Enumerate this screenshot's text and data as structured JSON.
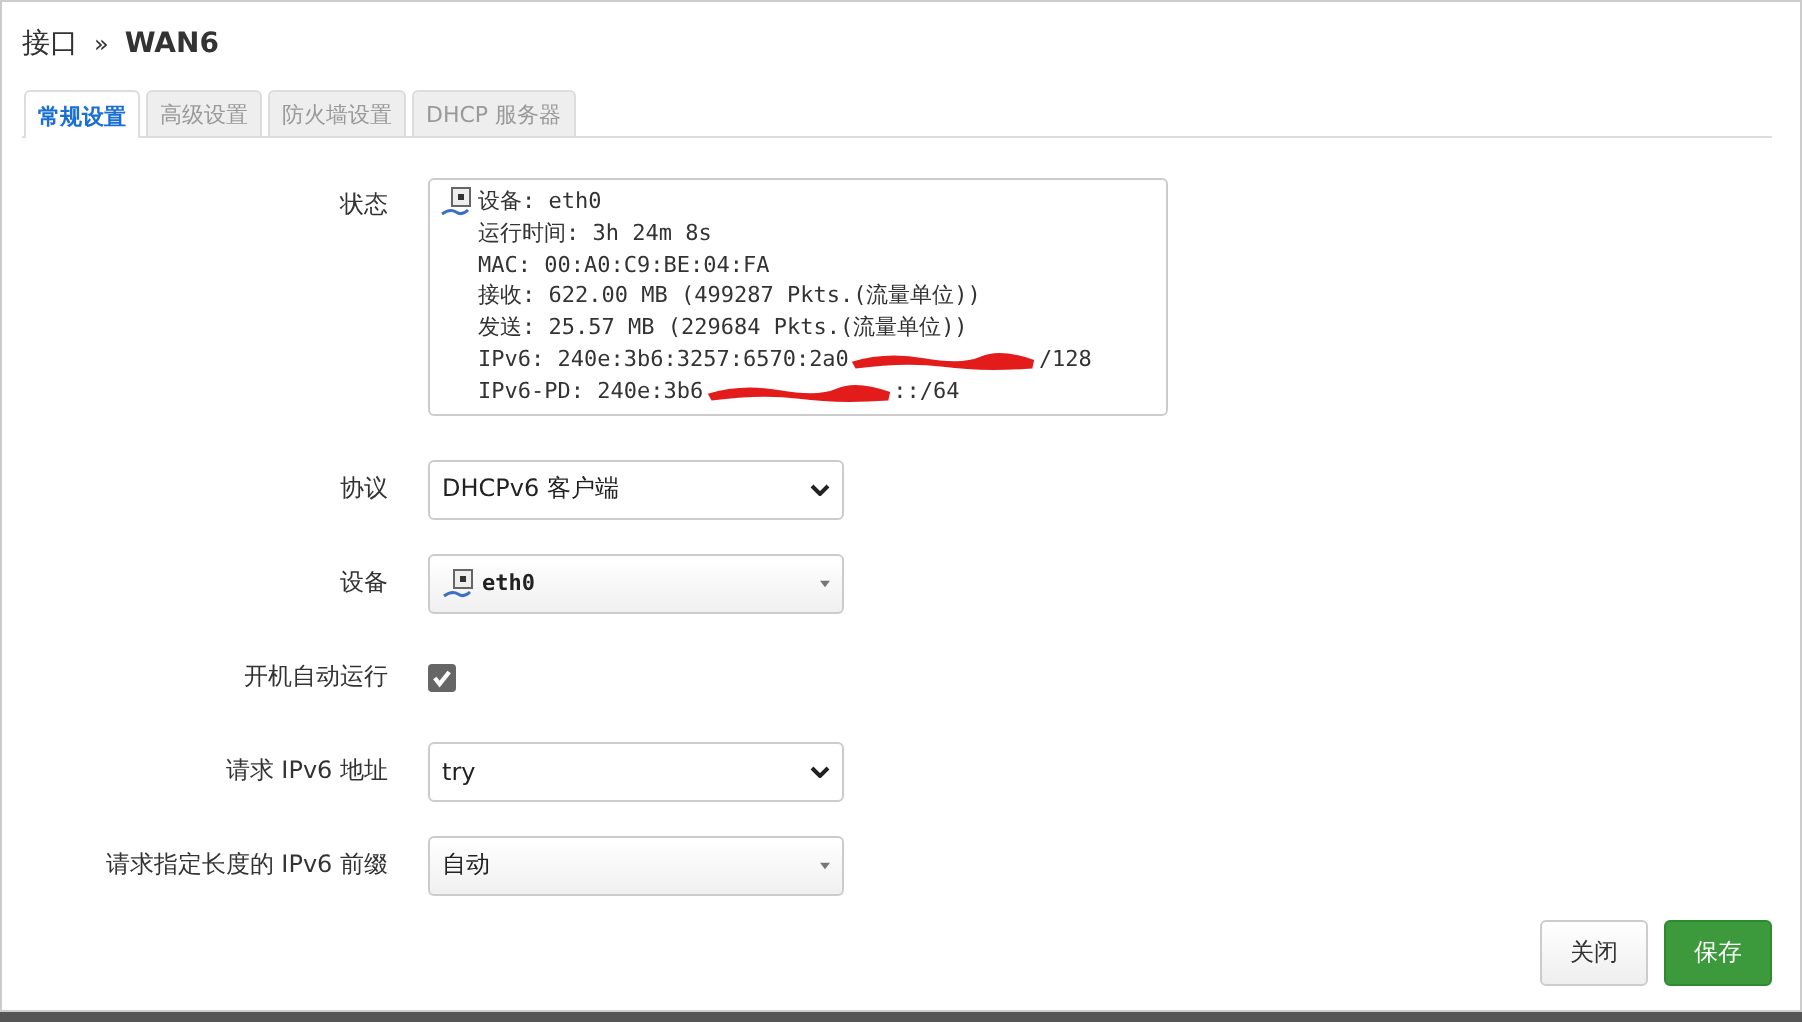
{
  "title": {
    "prefix": "接口",
    "separator": "»",
    "name": "WAN6"
  },
  "tabs": [
    {
      "label": "常规设置",
      "selected": true
    },
    {
      "label": "高级设置",
      "selected": false
    },
    {
      "label": "防火墙设置",
      "selected": false
    },
    {
      "label": "DHCP 服务器",
      "selected": false
    }
  ],
  "status": {
    "label": "状态",
    "lines": [
      {
        "text": "设备: eth0",
        "redacted": false
      },
      {
        "text": "运行时间: 3h 24m 8s",
        "redacted": false
      },
      {
        "text": "MAC: 00:A0:C9:BE:04:FA",
        "redacted": false
      },
      {
        "text": "接收: 622.00 MB (499287 Pkts.(流量单位))",
        "redacted": false
      },
      {
        "text": "发送: 25.57 MB (229684 Pkts.(流量单位))",
        "redacted": false
      },
      {
        "text": "IPv6: 240e:3b6:3257:6570:2a0",
        "after": "/128",
        "redacted": true
      },
      {
        "text": "IPv6-PD: 240e:3b6",
        "after": "::/64",
        "redacted": true
      }
    ]
  },
  "fields": [
    {
      "label": "协议",
      "kind": "select",
      "value": "DHCPv6 客户端"
    },
    {
      "label": "设备",
      "kind": "dropdown",
      "value": "eth0",
      "device_icon": true
    },
    {
      "label": "开机自动运行",
      "kind": "checkbox",
      "checked": true
    },
    {
      "label": "请求 IPv6 地址",
      "kind": "select",
      "value": "try"
    },
    {
      "label": "请求指定长度的 IPv6 前缀",
      "kind": "dropdown",
      "value": "自动",
      "device_icon": false
    }
  ],
  "buttons": [
    {
      "label": "关闭",
      "kind": "secondary"
    },
    {
      "label": "保存",
      "kind": "primary"
    }
  ]
}
